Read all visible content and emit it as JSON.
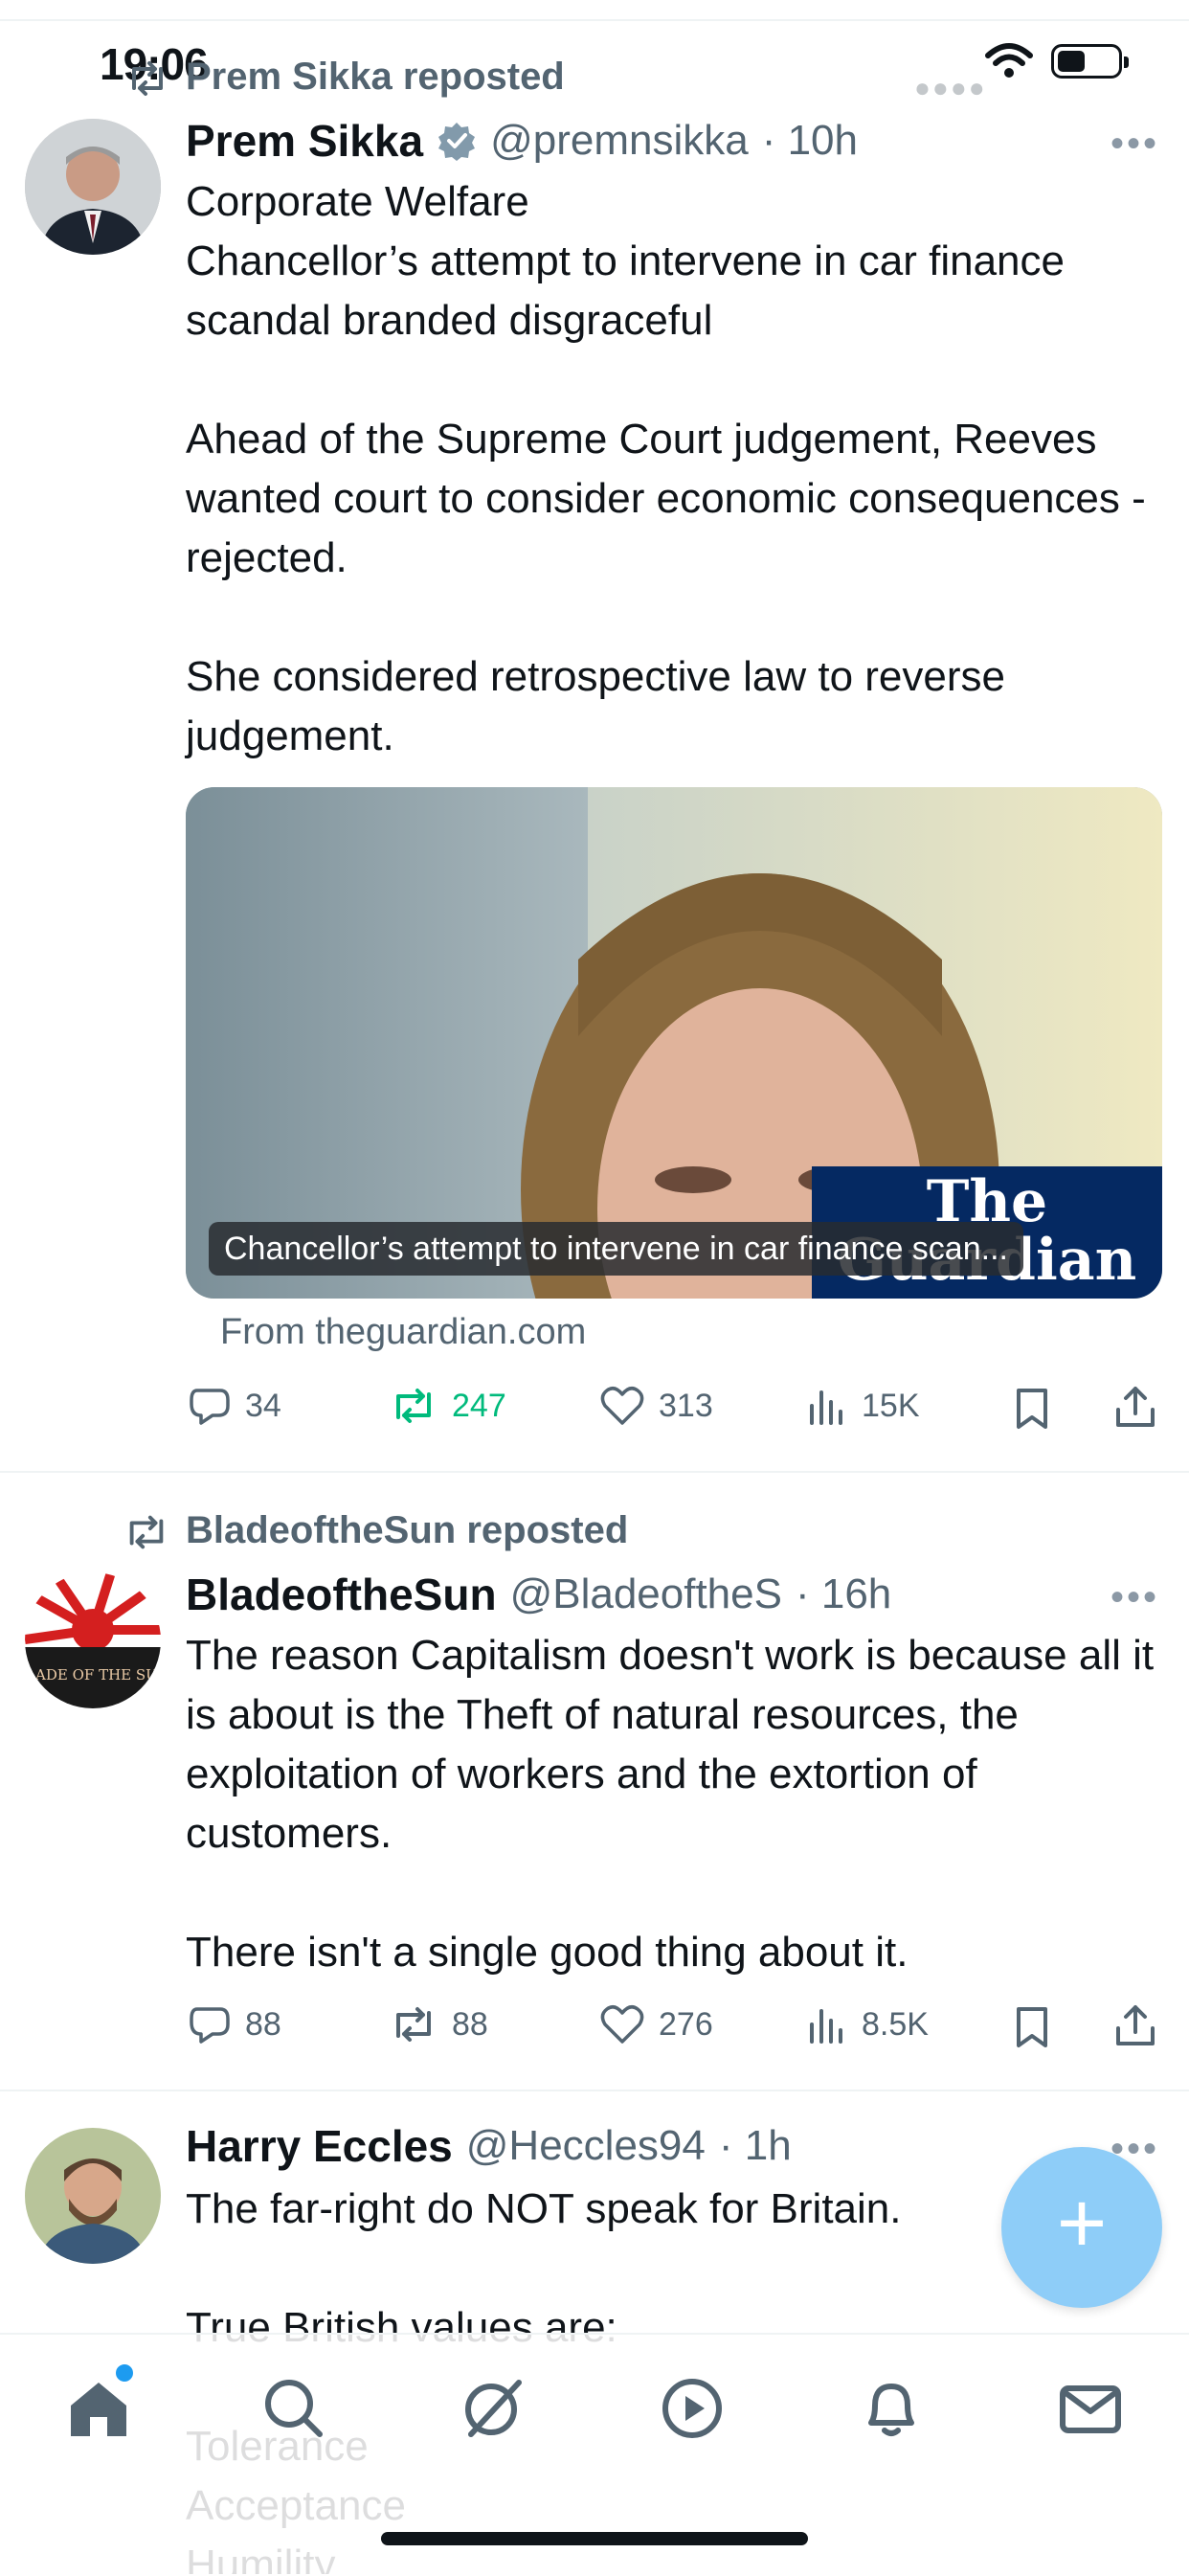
{
  "status_bar": {
    "time": "19:06"
  },
  "posts": [
    {
      "social_context": "Prem Sikka reposted",
      "name": "Prem Sikka",
      "handle": "@premnsikka",
      "time": "· 10h",
      "verified": true,
      "text": "Corporate Welfare\nChancellor’s attempt to intervene in car finance scandal branded disgraceful\n\nAhead of the Supreme Court judgement, Reeves wanted court to consider economic consequences - rejected.\n\nShe considered retrospective law to reverse judgement.",
      "card": {
        "caption": "Chancellor’s attempt to intervene in car finance scan...",
        "logo_line1": "The",
        "logo_line2": "Guardian",
        "source": "From theguardian.com"
      },
      "actions": {
        "replies": "34",
        "reposts": "247",
        "likes": "313",
        "views": "15K"
      }
    },
    {
      "social_context": "BladeoftheSun reposted",
      "name": "BladeoftheSun",
      "handle": "@BladeoftheS",
      "time": "· 16h",
      "avatar_text": "BLADE OF THE SUN",
      "text": "The reason Capitalism doesn't work is because all it is about is the Theft of natural resources, the exploitation of workers and the extortion of customers.\n\nThere isn't a single good thing about it.",
      "actions": {
        "replies": "88",
        "reposts": "88",
        "likes": "276",
        "views": "8.5K"
      }
    },
    {
      "name": "Harry Eccles",
      "handle": "@Heccles94",
      "time": "· 1h",
      "text": "The far-right do NOT speak for Britain.\n\nTrue British values are:\n\nTolerance\nAcceptance\nHumility"
    }
  ],
  "fab": {
    "label": "+"
  },
  "tabbar": [
    "home-icon",
    "search-icon",
    "grok-icon",
    "video-icon",
    "notifications-icon",
    "messages-icon"
  ],
  "colors": {
    "accent": "#1d9bf0",
    "repost_green": "#00ba7c",
    "muted": "#536471",
    "fab": "#8ecdf8"
  }
}
